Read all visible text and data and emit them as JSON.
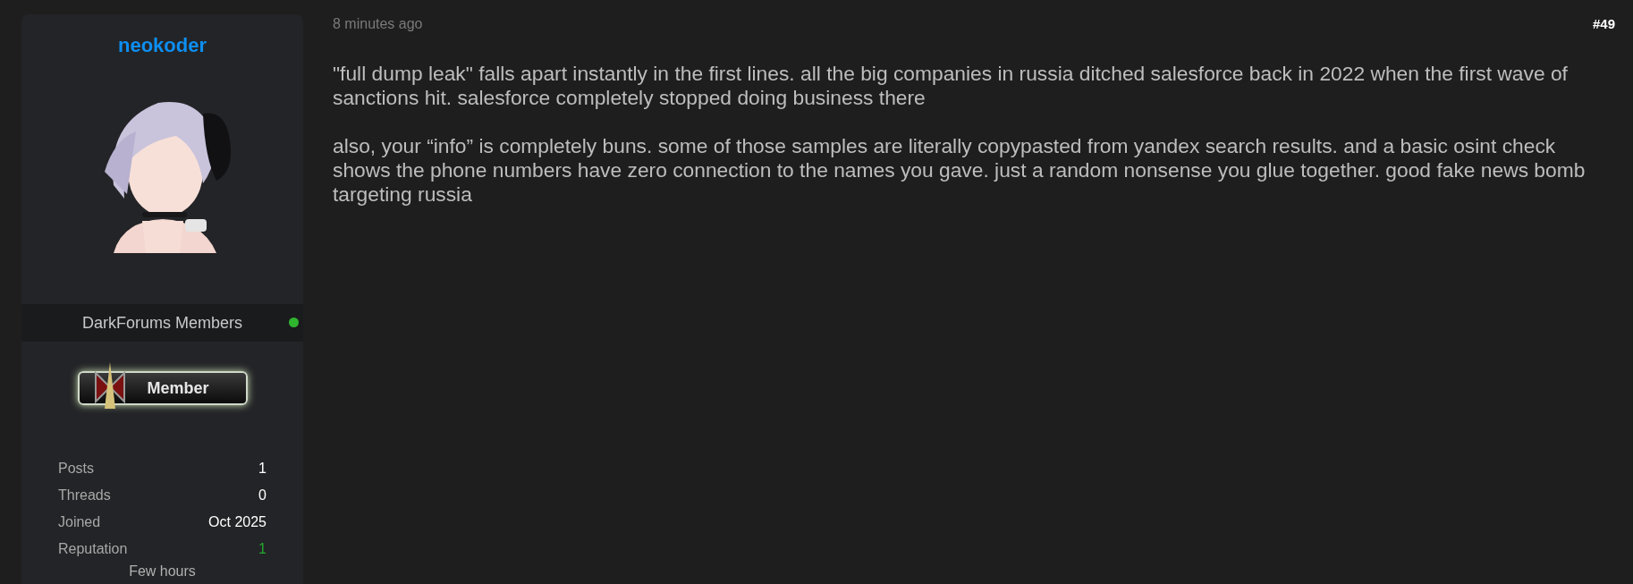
{
  "author": {
    "username": "neokoder",
    "group": "DarkForums Members",
    "online": true,
    "rank_badge": "Member",
    "stats": [
      {
        "label": "Posts",
        "value": "1",
        "kind": "plain"
      },
      {
        "label": "Threads",
        "value": "0",
        "kind": "plain"
      },
      {
        "label": "Joined",
        "value": "Oct 2025",
        "kind": "plain"
      },
      {
        "label": "Reputation",
        "value": "1",
        "kind": "positive"
      }
    ],
    "last_seen": "Few hours"
  },
  "post": {
    "time": "8 minutes ago",
    "number": "#49",
    "paragraphs": [
      "\"full dump leak\" falls apart instantly in the first lines. all the big companies in russia ditched salesforce back in 2022 when the first wave of sanctions hit. salesforce completely stopped doing business there",
      "also, your “info” is completely buns. some of those samples are literally copypasted from yandex search results. and a basic osint check shows the phone numbers have zero connection to the names you gave. just a random nonsense you glue together. good fake news bomb targeting russia"
    ]
  }
}
